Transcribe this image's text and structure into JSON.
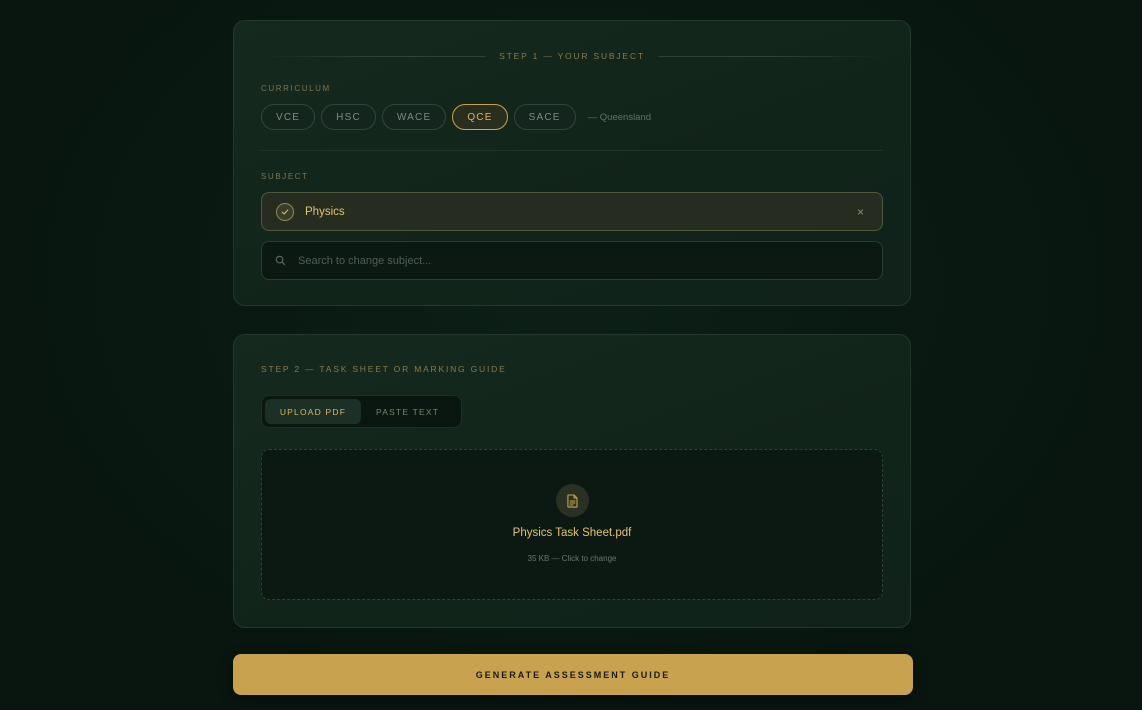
{
  "step1": {
    "heading": "STEP 1 — YOUR SUBJECT",
    "curriculum_label": "CURRICULUM",
    "curricula": [
      {
        "label": "VCE",
        "selected": false
      },
      {
        "label": "HSC",
        "selected": false
      },
      {
        "label": "WACE",
        "selected": false
      },
      {
        "label": "QCE",
        "selected": true
      },
      {
        "label": "SACE",
        "selected": false
      }
    ],
    "region_note": "— Queensland",
    "subject_label": "SUBJECT",
    "selected_subject": "Physics",
    "clear_symbol": "×",
    "search_placeholder": "Search to change subject...",
    "search_value": ""
  },
  "step2": {
    "heading": "STEP 2 — TASK SHEET OR MARKING GUIDE",
    "modes": [
      {
        "label": "UPLOAD PDF",
        "selected": true
      },
      {
        "label": "PASTE TEXT",
        "selected": false
      }
    ],
    "file_name": "Physics Task Sheet.pdf",
    "file_meta": "35 KB — Click to change"
  },
  "generate_button": "GENERATE ASSESSMENT GUIDE",
  "colors": {
    "accent": "#c9a250",
    "accent_text": "#e2c46b",
    "background": "#08160f",
    "card": "#13271d"
  },
  "icons": {
    "check": "check-icon",
    "close": "close-icon",
    "search": "search-icon",
    "file": "document-icon"
  }
}
